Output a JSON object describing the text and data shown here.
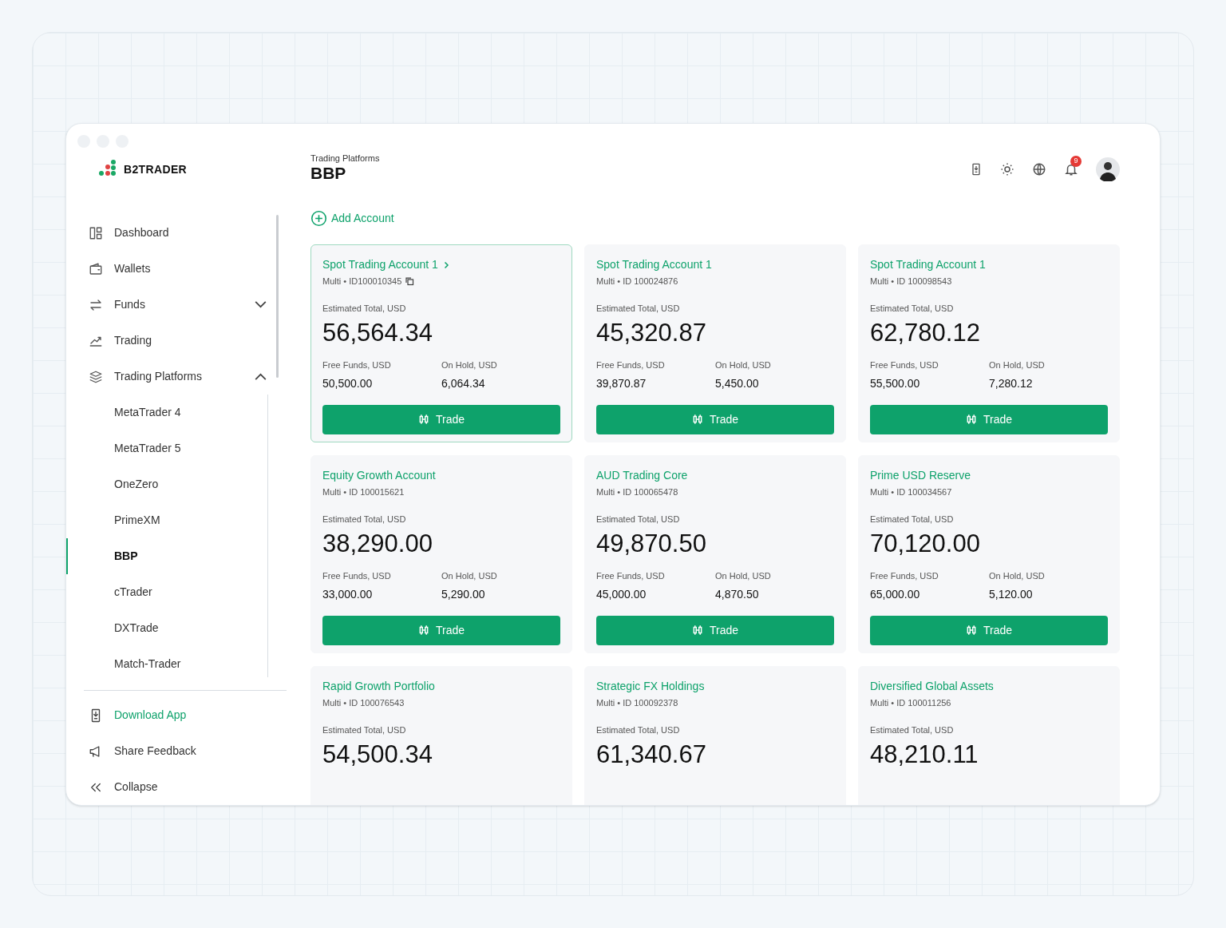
{
  "brand": {
    "name": "B2TRADER"
  },
  "header": {
    "breadcrumb": "Trading Platforms",
    "title": "BBP",
    "notifications": "9"
  },
  "sidebar": {
    "items": [
      {
        "label": "Dashboard"
      },
      {
        "label": "Wallets"
      },
      {
        "label": "Funds",
        "expanded": false
      },
      {
        "label": "Trading"
      },
      {
        "label": "Trading Platforms",
        "expanded": true,
        "children": [
          {
            "label": "MetaTrader 4",
            "selected": false
          },
          {
            "label": "MetaTrader 5",
            "selected": false
          },
          {
            "label": "OneZero",
            "selected": false
          },
          {
            "label": "PrimeXM",
            "selected": false
          },
          {
            "label": "BBP",
            "selected": true
          },
          {
            "label": "cTrader",
            "selected": false
          },
          {
            "label": "DXTrade",
            "selected": false
          },
          {
            "label": "Match-Trader",
            "selected": false
          }
        ]
      }
    ],
    "footer": [
      {
        "label": "Download App",
        "selected": true
      },
      {
        "label": "Share Feedback",
        "selected": false
      },
      {
        "label": "Collapse",
        "selected": false
      }
    ]
  },
  "add_account": "Add Account",
  "cards": [
    {
      "name": "Spot Trading Account 1",
      "selected": true,
      "meta": "Multi • ID100010345",
      "total_label": "Estimated Total, USD",
      "total": "56,564.34",
      "free_label": "Free Funds, USD",
      "free": "50,500.00",
      "hold_label": "On Hold, USD",
      "hold": "6,064.34",
      "button": "Trade"
    },
    {
      "name": "Spot Trading Account 1",
      "selected": false,
      "meta": "Multi • ID 100024876",
      "total_label": "Estimated Total, USD",
      "total": "45,320.87",
      "free_label": "Free Funds, USD",
      "free": "39,870.87",
      "hold_label": "On Hold, USD",
      "hold": "5,450.00",
      "button": "Trade"
    },
    {
      "name": "Spot Trading Account 1",
      "selected": false,
      "meta": "Multi • ID 100098543",
      "total_label": "Estimated Total, USD",
      "total": "62,780.12",
      "free_label": "Free Funds, USD",
      "free": "55,500.00",
      "hold_label": "On Hold, USD",
      "hold": "7,280.12",
      "button": "Trade"
    },
    {
      "name": "Equity Growth Account",
      "selected": false,
      "meta": "Multi • ID 100015621",
      "total_label": "Estimated Total, USD",
      "total": "38,290.00",
      "free_label": "Free Funds, USD",
      "free": "33,000.00",
      "hold_label": "On Hold, USD",
      "hold": "5,290.00",
      "button": "Trade"
    },
    {
      "name": "AUD Trading Core",
      "selected": false,
      "meta": "Multi • ID 100065478",
      "total_label": "Estimated Total, USD",
      "total": "49,870.50",
      "free_label": "Free Funds, USD",
      "free": "45,000.00",
      "hold_label": "On Hold, USD",
      "hold": "4,870.50",
      "button": "Trade"
    },
    {
      "name": "Prime USD Reserve",
      "selected": false,
      "meta": "Multi • ID 100034567",
      "total_label": "Estimated Total, USD",
      "total": "70,120.00",
      "free_label": "Free Funds, USD",
      "free": "65,000.00",
      "hold_label": "On Hold, USD",
      "hold": "5,120.00",
      "button": "Trade"
    },
    {
      "name": "Rapid Growth Portfolio",
      "selected": false,
      "meta": "Multi • ID 100076543",
      "total_label": "Estimated Total, USD",
      "total": "54,500.34"
    },
    {
      "name": "Strategic FX Holdings",
      "selected": false,
      "meta": "Multi • ID 100092378",
      "total_label": "Estimated Total, USD",
      "total": "61,340.67"
    },
    {
      "name": "Diversified Global Assets",
      "selected": false,
      "meta": "Multi • ID 100011256",
      "total_label": "Estimated Total, USD",
      "total": "48,210.11"
    }
  ]
}
